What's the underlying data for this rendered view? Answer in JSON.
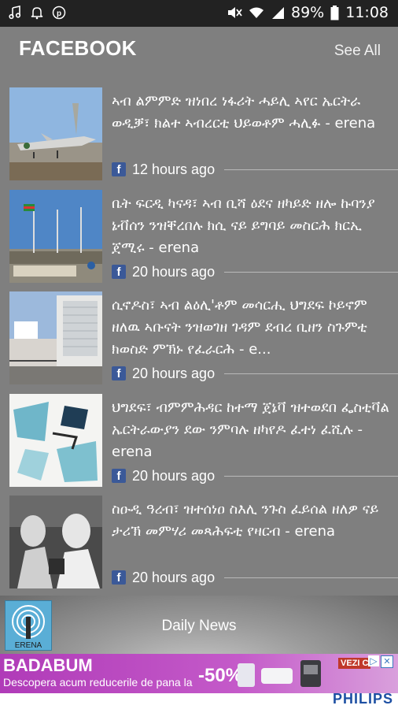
{
  "status_bar": {
    "left_icons": [
      "music-note-icon",
      "bell-icon",
      "pinterest-icon"
    ],
    "right_icons": [
      "mute-icon",
      "wifi-icon",
      "signal-icon",
      "battery-icon"
    ],
    "battery": "89%",
    "time": "11:08"
  },
  "section": {
    "title": "FACEBOOK",
    "see_all": "See All"
  },
  "items": [
    {
      "title": "ኣብ ልምምድ ዝነበረ ነፋሪት ሓይሊ ኣየር ኤርትራ ወዲቓ፣ ክልተ ኣብረርቲ ህይወቶም ሓሊፉ - erena",
      "time": "12 hours ago",
      "source_icon": "facebook-icon"
    },
    {
      "title": "ቤት ፍርዲ ካናዳ፣ ኣብ ቢሻ ዕደና ዘካይድ ዘሎ ኩባንያ ኔቭሰን ንዝቐረበሉ ክሲ ናይ ይግባይ መስርሕ ክርኢ ጀሚሩ - erena",
      "time": "20 hours ago",
      "source_icon": "facebook-icon"
    },
    {
      "title": "ሲኖዶስ፣ ኣብ ልዕሊ'ቶም መሳርሒ ህግደፍ ኮይኖም ዘለዉ ኣቡናት ንዝወገዘ ገዳም ደብረ ቢዘን ስጉምቲ ክወስድ ምኽኑ የፈራርሕ - e...",
      "time": "20 hours ago",
      "source_icon": "facebook-icon"
    },
    {
      "title": "ህግደፍ፣ ብምምሕዳር ከተማ ጀኔቫ ዝተወደበ ፌስቲቫል ኤርትራውያን ደው ንምባሉ ዘካየዶ ፈተነ ፈሺሉ - erena",
      "time": "20 hours ago",
      "source_icon": "facebook-icon"
    },
    {
      "title": "ስዑዲ ዓረብ፣ ዝተሰነዐ ስእሊ ንጉስ ፈይሰል ዘለዎ ናይ ታሪኽ መምሃሪ መጻሕፍቲ የዛርብ - erena",
      "time": "20 hours ago",
      "source_icon": "facebook-icon"
    }
  ],
  "bottom": {
    "logo_text": "ERENA",
    "label": "Daily News"
  },
  "ad": {
    "brand": "BADABUM",
    "subtitle": "Descopera acum reducerile de pana la",
    "percent": "-50%",
    "tag": "VEZI C",
    "sponsor": "PHILIPS"
  }
}
